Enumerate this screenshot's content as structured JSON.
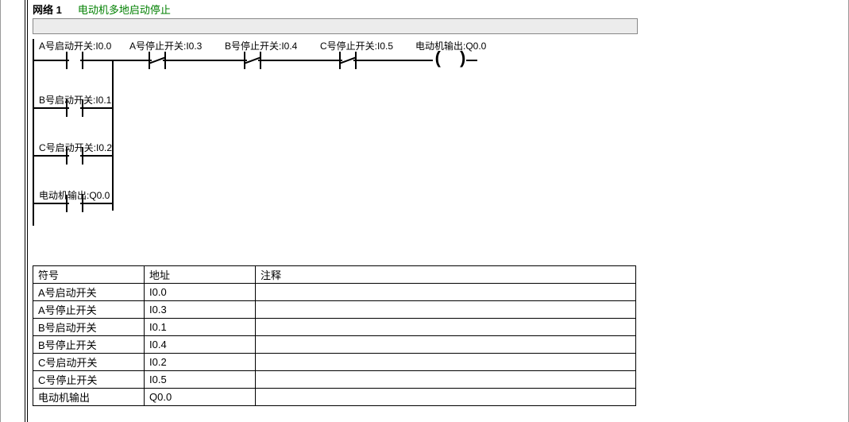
{
  "network": {
    "title": "网络 1",
    "desc": "电动机多地启动停止"
  },
  "labels": {
    "a_start": "A号启动开关:I0.0",
    "a_stop": "A号停止开关:I0.3",
    "b_stop": "B号停止开关:I0.4",
    "c_stop": "C号停止开关:I0.5",
    "out": "电动机输出:Q0.0",
    "b_start": "B号启动开关:I0.1",
    "c_start": "C号启动开关:I0.2",
    "out_fb": "电动机输出:Q0.0"
  },
  "table": {
    "headers": {
      "symbol": "符号",
      "address": "地址",
      "comment": "注释"
    },
    "rows": [
      {
        "symbol": "A号启动开关",
        "address": "I0.0",
        "comment": ""
      },
      {
        "symbol": "A号停止开关",
        "address": "I0.3",
        "comment": ""
      },
      {
        "symbol": "B号启动开关",
        "address": "I0.1",
        "comment": ""
      },
      {
        "symbol": "B号停止开关",
        "address": "I0.4",
        "comment": ""
      },
      {
        "symbol": "C号启动开关",
        "address": "I0.2",
        "comment": ""
      },
      {
        "symbol": "C号停止开关",
        "address": "I0.5",
        "comment": ""
      },
      {
        "symbol": "电动机输出",
        "address": "Q0.0",
        "comment": ""
      }
    ]
  },
  "chart_data": {
    "type": "ladder",
    "rungs": [
      {
        "parallel_start_branches": [
          {
            "element": "NO_contact",
            "symbol": "A号启动开关",
            "address": "I0.0"
          },
          {
            "element": "NO_contact",
            "symbol": "B号启动开关",
            "address": "I0.1"
          },
          {
            "element": "NO_contact",
            "symbol": "C号启动开关",
            "address": "I0.2"
          },
          {
            "element": "NO_contact",
            "symbol": "电动机输出",
            "address": "Q0.0"
          }
        ],
        "series_after_parallel": [
          {
            "element": "NC_contact",
            "symbol": "A号停止开关",
            "address": "I0.3"
          },
          {
            "element": "NC_contact",
            "symbol": "B号停止开关",
            "address": "I0.4"
          },
          {
            "element": "NC_contact",
            "symbol": "C号停止开关",
            "address": "I0.5"
          }
        ],
        "output": {
          "element": "coil",
          "symbol": "电动机输出",
          "address": "Q0.0"
        }
      }
    ]
  }
}
